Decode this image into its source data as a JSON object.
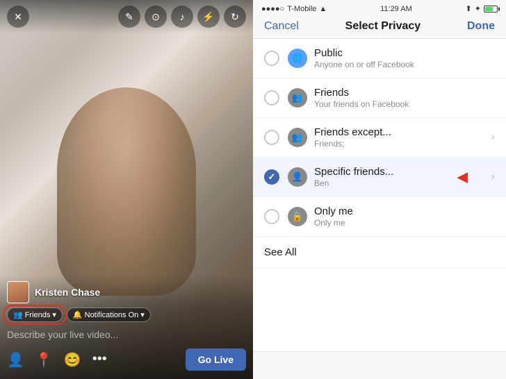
{
  "left": {
    "user_name": "Kristen Chase",
    "friends_pill_label": "Friends",
    "notifications_pill_label": "Notifications On",
    "describe_placeholder": "Describe your live video...",
    "go_live_label": "Go Live",
    "toolbar_buttons": [
      "✕",
      "✎",
      "📹",
      "🎤",
      "⚡",
      "🔄"
    ]
  },
  "right": {
    "status_bar": {
      "carrier": "T-Mobile",
      "time": "11:29 AM",
      "bluetooth": "BT",
      "signal": "▲"
    },
    "nav": {
      "cancel": "Cancel",
      "title": "Select Privacy",
      "done": "Done"
    },
    "items": [
      {
        "id": "public",
        "title": "Public",
        "subtitle": "Anyone on or off Facebook",
        "icon": "🌐",
        "icon_type": "globe",
        "selected": false,
        "has_chevron": false
      },
      {
        "id": "friends",
        "title": "Friends",
        "subtitle": "Your friends on Facebook",
        "icon": "👥",
        "icon_type": "people",
        "selected": false,
        "has_chevron": false
      },
      {
        "id": "friends-except",
        "title": "Friends except...",
        "subtitle": "Friends;",
        "icon": "👥",
        "icon_type": "people",
        "selected": false,
        "has_chevron": true
      },
      {
        "id": "specific-friends",
        "title": "Specific friends...",
        "subtitle": "Ben",
        "icon": "👤",
        "icon_type": "person",
        "selected": true,
        "has_chevron": true,
        "has_arrow": true
      },
      {
        "id": "only-me",
        "title": "Only me",
        "subtitle": "Only me",
        "icon": "🔒",
        "icon_type": "lock",
        "selected": false,
        "has_chevron": false
      }
    ],
    "see_all": "See All"
  }
}
